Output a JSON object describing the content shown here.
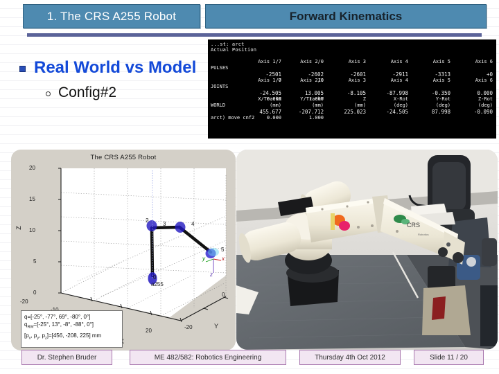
{
  "header": {
    "tab_title": "1. The CRS A255 Robot",
    "topic": "Forward Kinematics"
  },
  "bullets": {
    "level1": "Real World vs Model",
    "level2": "Config#2"
  },
  "terminal": {
    "line1": "...st: arct",
    "line2": "Actual Position",
    "rows": [
      {
        "label": "PULSES",
        "headers": [
          "Axis 1/7",
          "Axis 2/0",
          "Axis 3",
          "Axis 4",
          "Axis 5",
          "Axis 6"
        ],
        "units": [
          "",
          "",
          "",
          "",
          "",
          ""
        ],
        "values": [
          "-2501",
          "-2602",
          "-2601",
          "-2911",
          "-3313",
          "+0"
        ],
        "values2": [
          "0",
          "10",
          "",
          "",
          "",
          ""
        ]
      },
      {
        "label": "JOINTS",
        "headers": [
          "Axis 1/7",
          "Axis 2/0",
          "Axis 3",
          "Axis 4",
          "Axis 5",
          "Axis 6"
        ],
        "units": [
          "",
          "",
          "",
          "",
          "",
          ""
        ],
        "values": [
          "-24.505",
          "13.005",
          "-8.105",
          "-87.998",
          "-0.350",
          "0.000"
        ],
        "values2": [
          "0.000",
          "1.000",
          "",
          "",
          "",
          ""
        ]
      },
      {
        "label": "WORLD",
        "headers": [
          "X/TrackX",
          "Y/TrackY",
          "Z",
          "X-Rot",
          "Y-Rot",
          "Z-Rot"
        ],
        "units": [
          "(mm)",
          "(mm)",
          "(mm)",
          "(deg)",
          "(deg)",
          "(deg)"
        ],
        "values": [
          "455.677",
          "-207.712",
          "225.023",
          "-24.505",
          "87.998",
          "-0.090"
        ],
        "values2": [
          "0.000",
          "1.000",
          "",
          "",
          "",
          ""
        ]
      }
    ],
    "prompt": "arct) move cnf2"
  },
  "figure": {
    "title": "The CRS A255 Robot",
    "annotation": {
      "line1": "q=[-25°, -77°, 69°, -80°, 0°]",
      "line2_pre": "q",
      "line2_sub": "RW",
      "line2_post": "=[-25°, 13°, -8°, -88°, 0°]",
      "line3_pre": "[p",
      "line3_sub1": "x",
      "line3_mid1": ", p",
      "line3_sub2": "y",
      "line3_mid2": ", p",
      "line3_sub3": "z",
      "line3_post": "]=[456, -208, 225] mm"
    },
    "axis_labels": {
      "x": "X",
      "y": "Y",
      "z": "Z"
    },
    "z_ticks": [
      "20",
      "15",
      "10",
      "5",
      "0"
    ],
    "x_ticks": [
      "-20",
      "-10",
      "0",
      "10",
      "20"
    ],
    "y_ticks": [
      "-20",
      "0"
    ],
    "joint_labels": [
      "2",
      "3",
      "4",
      "5"
    ],
    "base_label": "a255",
    "base_index": "0",
    "frame_labels": {
      "x": "x",
      "y": "y",
      "z": "z"
    }
  },
  "chart_data": {
    "type": "scatter",
    "title": "The CRS A255 Robot",
    "xlabel": "X",
    "ylabel": "Y",
    "zlabel": "Z",
    "xlim": [
      -20,
      20
    ],
    "ylim": [
      -20,
      0
    ],
    "zlim": [
      0,
      20
    ],
    "grid": true,
    "joint_angles_deg": [
      -25,
      -77,
      69,
      -80,
      0
    ],
    "joint_angles_rw_deg": [
      -25,
      13,
      -8,
      -88,
      0
    ],
    "end_effector_mm": {
      "px": 456,
      "py": -208,
      "pz": 225
    }
  },
  "footer": {
    "author": "Dr. Stephen Bruder",
    "course": "ME 482/582: Robotics Engineering",
    "date": "Thursday 4th Oct 2012",
    "slide": "Slide 11 /  20"
  },
  "colors": {
    "tab_blue": "#4e8ab0",
    "rule_purple": "#5b6399",
    "bullet_blue": "#1349d8",
    "footer_border": "#a877ae",
    "footer_fill": "#f2e6f2",
    "figure_gray": "#d4d0c8"
  }
}
